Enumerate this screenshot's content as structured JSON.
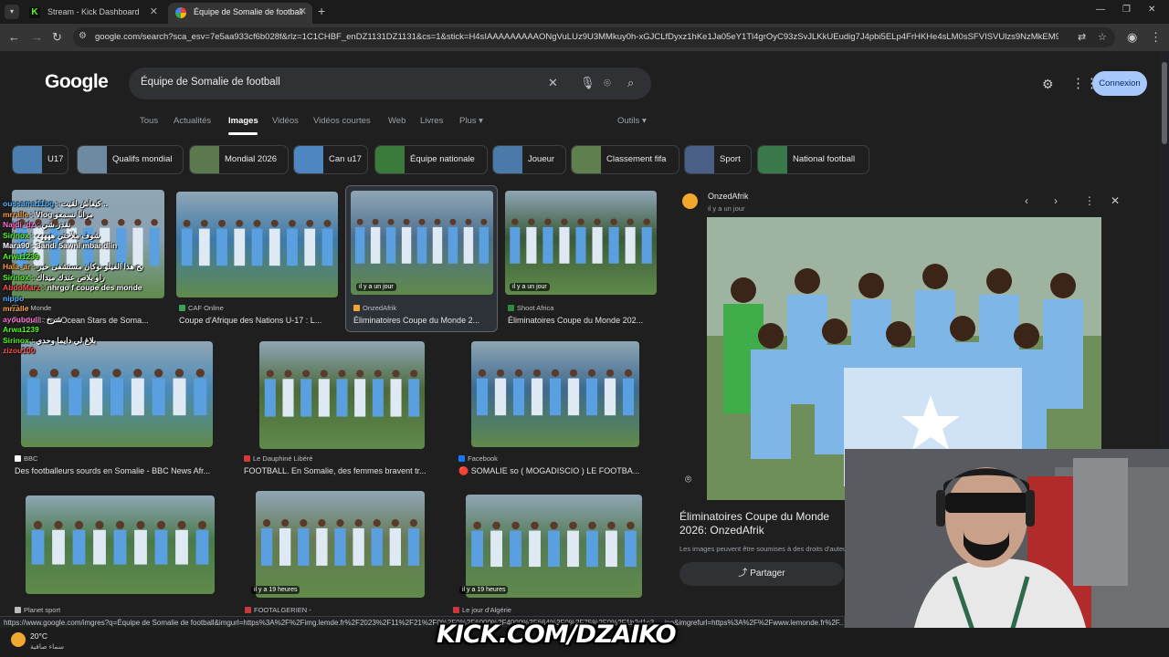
{
  "browser": {
    "tabs": [
      {
        "title": "Stream - Kick Dashboard"
      },
      {
        "title": "Équipe de Somalie de football"
      }
    ],
    "url": "google.com/search?sca_esv=7e5aa933cf6b028f&rlz=1C1CHBF_enDZ1131DZ1131&cs=1&stick=H4sIAAAAAAAAAONgVuLUz9U3MMkuy0h-xGJCLfDyxz1hKe1Ja05eY1Tl4grOyC93zSvJLKkUEudig7J4pbi5ELp4FrHKHe4sLM0sSFVISVUlzs9NzMkEM9Py80uSEnNyAD..."
  },
  "google": {
    "logo": "Google",
    "query": "Équipe de Somalie de football",
    "signin_label": "Connexion",
    "tabs": [
      "Tous",
      "Actualités",
      "Images",
      "Vidéos",
      "Vidéos courtes",
      "Web",
      "Livres",
      "Plus"
    ],
    "tools_label": "Outils",
    "chips": [
      "U17",
      "Qualifs mondial",
      "Mondial 2026",
      "Can u17",
      "Équipe nationale",
      "Joueur",
      "Classement fifa",
      "Sport",
      "National football"
    ]
  },
  "results": [
    {
      "source": "Le Monde",
      "title": "Football : les Ocean Stars de Soma...",
      "badge": "",
      "color": "#8aa0b0"
    },
    {
      "source": "CAF Online",
      "title": "Coupe d'Afrique des Nations U-17 : L...",
      "badge": "",
      "color": "#3f7aa8"
    },
    {
      "source": "OnzedAfrik",
      "title": "Éliminatoires Coupe du Monde 2...",
      "badge": "il y a un jour",
      "color": "#4d6f8e"
    },
    {
      "source": "Shoot Africa",
      "title": "Éliminatoires Coupe du Monde 202...",
      "badge": "il y a un jour",
      "color": "#3a5a3a"
    },
    {
      "source": "BBC",
      "title": "Des footballeurs sourds en Somalie - BBC News Afr...",
      "badge": "",
      "color": "#4a8ab8"
    },
    {
      "source": "Le Dauphiné Libéré",
      "title": "FOOTBALL. En Somalie, des femmes bravent tr...",
      "badge": "",
      "color": "#4c6a3a"
    },
    {
      "source": "Facebook",
      "title": "🔴 SOMALIE so ( MOGADISCIO ) LE FOOTBA...",
      "badge": "",
      "color": "#3d6a8e"
    },
    {
      "source": "Planet sport",
      "title": "",
      "badge": "",
      "color": "#4a7a4a"
    },
    {
      "source": "FOOTALGERIEN -",
      "title": "",
      "badge": "il y a 19 heures",
      "color": "#667a55"
    },
    {
      "source": "Le jour d'Algérie",
      "title": "",
      "badge": "il y a 19 heures",
      "color": "#557a55"
    }
  ],
  "panel": {
    "source": "OnzedAfrik",
    "time": "il y a un jour",
    "title": "Éliminatoires Coupe du Monde 2026: OnzedAfrik",
    "copyright": "Les images peuvent être soumises à des droits d'auteur.",
    "share_label": "Partager"
  },
  "status_url": "https://www.google.com/imgres?q=Équipe de Somalie de football&imgurl=https%3A%2F%2Fimg.lemde.fr%2F2023%2F11%2F21%2F0%2F0%2F6000%2F4000%2F664%2F0%2F75%2F0%2F1b2d1c3_...jpg&imgrefurl=https%3A%2F%2Fwww.lemonde.fr%2F...",
  "taskbar": {
    "temp": "20°C",
    "weather": "سماء صافية"
  },
  "stream": {
    "overlay_text": "KICK.COM/DZAIKO",
    "chat": [
      {
        "user": "oussama11bg",
        "msg": "كيفاش لقيت ..",
        "color": "#4fb3ff"
      },
      {
        "user": "mrralle",
        "msg": "Vlog مرانا نسمعو",
        "color": "#ff9f3f"
      },
      {
        "user": "Najdi_dz",
        "msg": "نقدر شي",
        "color": "#ff6fcf"
      },
      {
        "user": "Sirinox",
        "msg": "شوف ملاحتي ههههه",
        "color": "#53fc18"
      },
      {
        "user": "Mara90",
        "msg": "3andi 5awni mbandlin",
        "color": "#ffffff"
      },
      {
        "user": "Arwa1239",
        "msg": "",
        "color": "#53fc18"
      },
      {
        "user": "Hala_ar",
        "msg": "بح هذا الفيلو نوكان مستشفى خير",
        "color": "#ff9f3f"
      },
      {
        "user": "Sirinox",
        "msg": "راو بلاص عندك ميداك",
        "color": "#53fc18"
      },
      {
        "user": "AbdoMarz",
        "msg": "nhrgo f coupe des monde",
        "color": "#ff4f4f"
      },
      {
        "user": "nippo",
        "msg": "",
        "color": "#4fb3ff"
      },
      {
        "user": "mrralle",
        "msg": "",
        "color": "#ff9f3f"
      },
      {
        "user": "ayoubouli",
        "msg": "شرح",
        "color": "#ff6fcf"
      },
      {
        "user": "Arwa1239",
        "msg": "",
        "color": "#53fc18"
      },
      {
        "user": "Sirinox",
        "msg": "بلاغ لي دايما وحدي",
        "color": "#53fc18"
      },
      {
        "user": "zizou100",
        "msg": "",
        "color": "#ff4f4f"
      }
    ]
  }
}
